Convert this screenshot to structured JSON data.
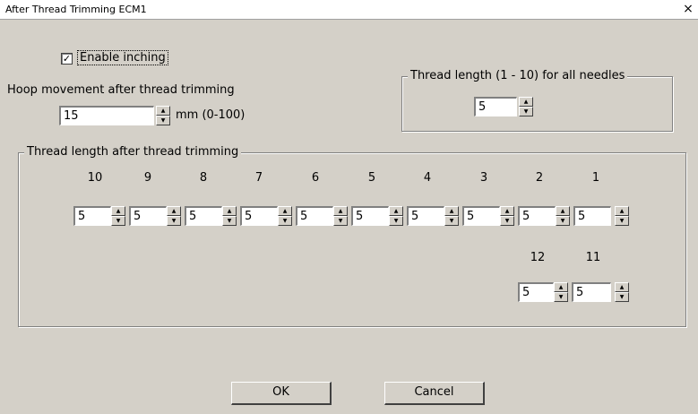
{
  "window": {
    "title": "After Thread Trimming ECM1",
    "close_glyph": "×"
  },
  "inching": {
    "label": "Enable inching",
    "checked": true,
    "check_glyph": "✓"
  },
  "hoop": {
    "label": "Hoop movement after thread trimming",
    "value": "15",
    "unit": "mm (0-100)"
  },
  "all_needles": {
    "title": "Thread length (1 - 10) for all needles",
    "value": "5"
  },
  "thread_group": {
    "title": "Thread length after thread trimming",
    "row1": [
      {
        "needle": "10",
        "value": "5"
      },
      {
        "needle": "9",
        "value": "5"
      },
      {
        "needle": "8",
        "value": "5"
      },
      {
        "needle": "7",
        "value": "5"
      },
      {
        "needle": "6",
        "value": "5"
      },
      {
        "needle": "5",
        "value": "5"
      },
      {
        "needle": "4",
        "value": "5"
      },
      {
        "needle": "3",
        "value": "5"
      },
      {
        "needle": "2",
        "value": "5"
      },
      {
        "needle": "1",
        "value": "5"
      }
    ],
    "row2": [
      {
        "needle": "12",
        "value": "5"
      },
      {
        "needle": "11",
        "value": "5"
      }
    ]
  },
  "buttons": {
    "ok": "OK",
    "cancel": "Cancel"
  },
  "spin_up_glyph": "▲",
  "spin_down_glyph": "▼"
}
